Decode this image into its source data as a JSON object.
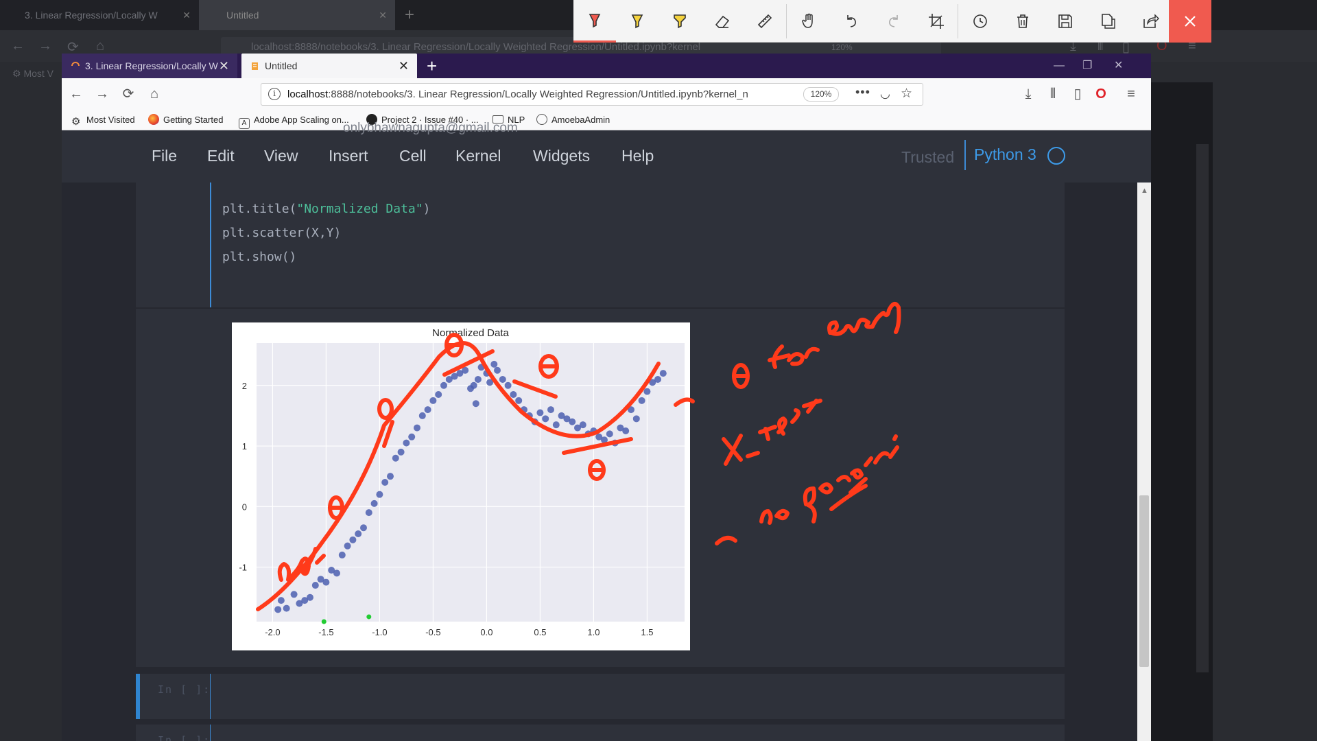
{
  "outer_browser": {
    "tabs": [
      "3. Linear Regression/Locally W",
      "Untitled"
    ],
    "url": "localhost:8888/notebooks/3. Linear Regression/Locally Weighted Regression/Untitled.ipynb?kernel",
    "zoom": "120%",
    "bookmark_label": "Most V"
  },
  "annotation_toolbar": {
    "tools": [
      "pen-red",
      "highlighter-yellow",
      "highlighter-yellow-2",
      "eraser",
      "ruler",
      "hand",
      "undo",
      "redo",
      "crop",
      "history",
      "delete",
      "save",
      "copy",
      "share",
      "close"
    ],
    "accent": "#f05a4f"
  },
  "browser": {
    "tabs": [
      {
        "label": "3. Linear Regression/Locally W",
        "active": false
      },
      {
        "label": "Untitled",
        "active": true
      }
    ],
    "url": "localhost:8888/notebooks/3. Linear Regression/Locally Weighted Regression/Untitled.ipynb?kernel_n",
    "url_host": "localhost",
    "url_rest": ":8888/notebooks/3. Linear Regression/Locally Weighted Regression/Untitled.ipynb?kernel_n",
    "zoom": "120%",
    "bookmarks": [
      {
        "label": "Most Visited",
        "icon": "gear-icon"
      },
      {
        "label": "Getting Started",
        "icon": "firefox-icon"
      },
      {
        "label": "Adobe App Scaling on...",
        "icon": "adobe-icon"
      },
      {
        "label": "Project 2 · Issue #40 · ...",
        "icon": "github-icon"
      },
      {
        "label": "NLP",
        "icon": "folder-icon"
      },
      {
        "label": "AmoebaAdmin",
        "icon": "globe-icon"
      }
    ]
  },
  "watermark": "onlybhawnagupta@gmail.com",
  "jupyter": {
    "menu": [
      "File",
      "Edit",
      "View",
      "Insert",
      "Cell",
      "Kernel",
      "Widgets",
      "Help"
    ],
    "trusted": "Trusted",
    "kernel": "Python 3",
    "code_lines": [
      {
        "pre": "plt.title(",
        "str": "\"Normalized Data\"",
        "post": ")"
      },
      {
        "pre": "plt.scatter(X,Y)",
        "str": "",
        "post": ""
      },
      {
        "pre": "plt.show()",
        "str": "",
        "post": ""
      }
    ],
    "empty_prompts": [
      "In [ ]:",
      "In [ ]:"
    ]
  },
  "chart_data": {
    "type": "scatter",
    "title": "Normalized Data",
    "xlabel": "",
    "ylabel": "",
    "xlim": [
      -2.15,
      1.85
    ],
    "ylim": [
      -1.9,
      2.7
    ],
    "xticks": [
      -2.0,
      -1.5,
      -1.0,
      -0.5,
      0.0,
      0.5,
      1.0,
      1.5
    ],
    "xtick_labels": [
      "-2.0",
      "-1.5",
      "-1.0",
      "-0.5",
      "0.0",
      "0.5",
      "1.0",
      "1.5"
    ],
    "yticks": [
      -1,
      0,
      1,
      2
    ],
    "ytick_labels": [
      "-1",
      "0",
      "1",
      "2"
    ],
    "grid": true,
    "background": "#eaeaf2",
    "point_color": "#4c5fb0",
    "series": [
      {
        "x": [
          -1.95,
          -1.92,
          -1.87,
          -1.8,
          -1.75,
          -1.7,
          -1.65,
          -1.6,
          -1.55,
          -1.5,
          -1.45,
          -1.4,
          -1.35,
          -1.3,
          -1.25,
          -1.2,
          -1.15,
          -1.1,
          -1.05,
          -1.0,
          -0.95,
          -0.9,
          -0.85,
          -0.8,
          -0.75,
          -0.7,
          -0.65,
          -0.6,
          -0.55,
          -0.5,
          -0.45,
          -0.4,
          -0.35,
          -0.3,
          -0.25,
          -0.2,
          -0.15,
          -0.12,
          -0.1,
          -0.08,
          -0.05,
          0.0,
          0.03,
          0.07,
          0.1,
          0.15,
          0.2,
          0.25,
          0.3,
          0.35,
          0.4,
          0.45,
          0.5,
          0.55,
          0.6,
          0.65,
          0.7,
          0.75,
          0.8,
          0.85,
          0.9,
          0.95,
          1.0,
          1.05,
          1.1,
          1.15,
          1.2,
          1.25,
          1.3,
          1.35,
          1.4,
          1.45,
          1.5,
          1.55,
          1.6,
          1.65
        ],
        "y": [
          -1.7,
          -1.55,
          -1.68,
          -1.45,
          -1.6,
          -1.55,
          -1.5,
          -1.3,
          -1.2,
          -1.25,
          -1.05,
          -1.1,
          -0.8,
          -0.65,
          -0.55,
          -0.45,
          -0.35,
          -0.1,
          0.05,
          0.2,
          0.4,
          0.5,
          0.8,
          0.9,
          1.05,
          1.15,
          1.3,
          1.5,
          1.6,
          1.75,
          1.85,
          2.0,
          2.1,
          2.15,
          2.2,
          2.25,
          1.95,
          2.0,
          1.7,
          2.1,
          2.3,
          2.2,
          2.05,
          2.35,
          2.25,
          2.1,
          2.0,
          1.85,
          1.75,
          1.6,
          1.5,
          1.4,
          1.55,
          1.45,
          1.6,
          1.35,
          1.5,
          1.45,
          1.4,
          1.3,
          1.35,
          1.2,
          1.25,
          1.15,
          1.1,
          1.2,
          1.05,
          1.3,
          1.25,
          1.6,
          1.45,
          1.75,
          1.9,
          2.05,
          2.1,
          2.2
        ],
        "highlight_green_x": [
          -1.52,
          -1.1
        ],
        "highlight_green_y": [
          -1.9,
          -1.82
        ]
      }
    ]
  },
  "annotations": {
    "ink_color": "#ff3a1a",
    "handwritten_text": [
      "θ for every",
      "x_test",
      "no generic"
    ]
  }
}
